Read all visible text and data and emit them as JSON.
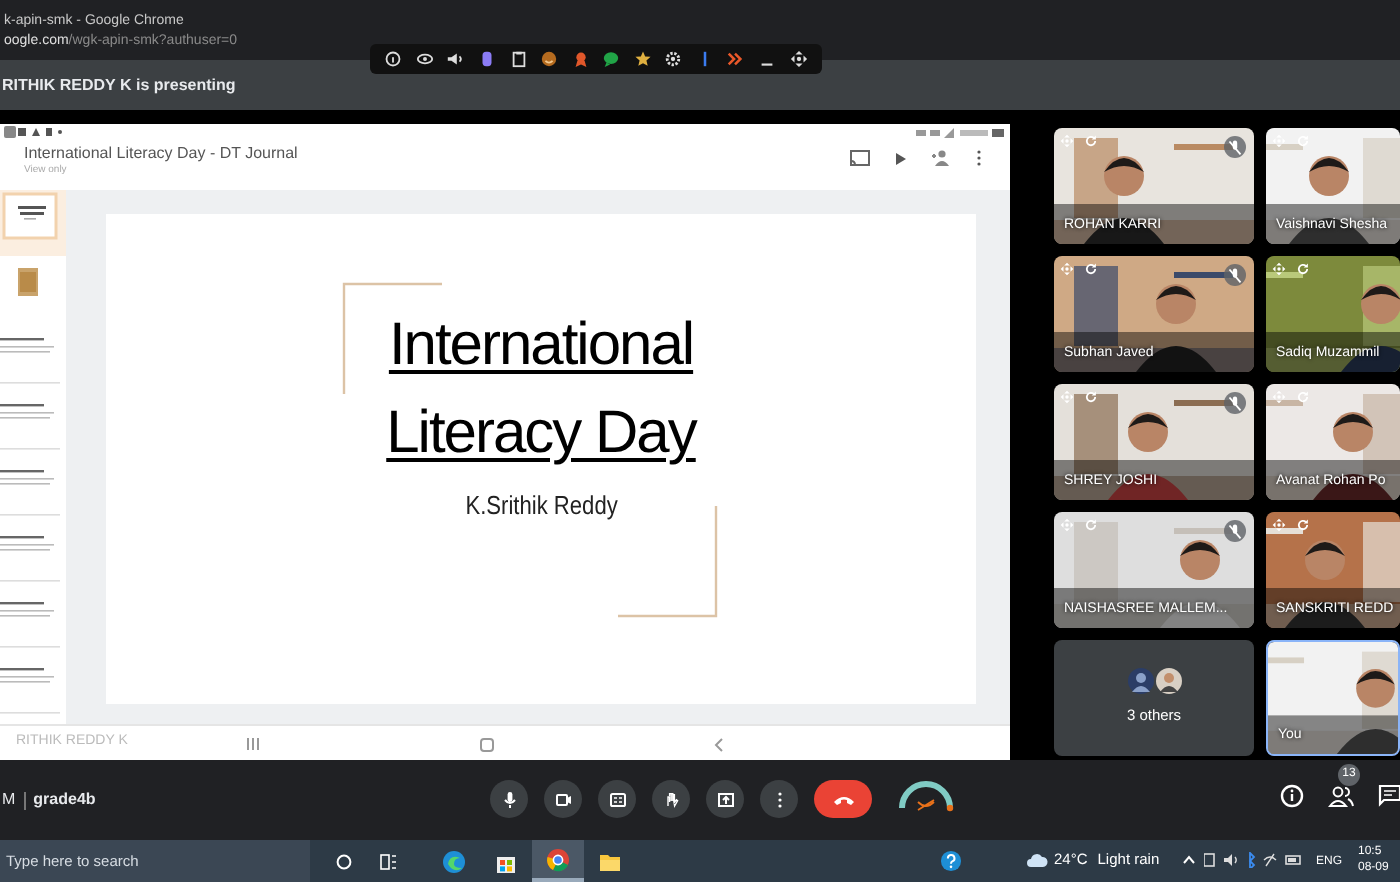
{
  "browser": {
    "title": "k-apin-smk - Google Chrome",
    "url_host": "oogle.com",
    "url_path": "/wgk-apin-smk?authuser=0"
  },
  "presenting_banner": "RITHIK REDDY K is presenting",
  "presentation": {
    "document_title": "International Literacy Day - DT Journal",
    "subtitle": "View only",
    "thumbnails": [
      {
        "selected": true
      },
      {
        "selected": false
      },
      {
        "selected": false
      },
      {
        "selected": false
      },
      {
        "selected": false
      },
      {
        "selected": false
      },
      {
        "selected": false
      },
      {
        "selected": false
      }
    ],
    "slide": {
      "title_lines": [
        "International",
        "Literacy Day"
      ],
      "author": "K.Srithik Reddy"
    },
    "presenter_label": "RITHIK REDDY K"
  },
  "tiles": [
    {
      "kind": "video",
      "name": "ROHAN KARRI",
      "muted": true
    },
    {
      "kind": "video",
      "name": "Vaishnavi Shesha",
      "muted": false
    },
    {
      "kind": "video",
      "name": "Subhan Javed",
      "muted": true
    },
    {
      "kind": "video",
      "name": "Sadiq Muzammil",
      "muted": false
    },
    {
      "kind": "video",
      "name": "SHREY JOSHI",
      "muted": true
    },
    {
      "kind": "video",
      "name": "Avanat Rohan Po",
      "muted": false
    },
    {
      "kind": "video",
      "name": "NAISHASREE MALLEM...",
      "muted": true
    },
    {
      "kind": "video",
      "name": "SANSKRITI REDD",
      "muted": false
    },
    {
      "kind": "others",
      "name": "3 others"
    },
    {
      "kind": "self",
      "name": "You"
    }
  ],
  "meeting": {
    "time_fragment": "M",
    "code": "grade4b",
    "participants_badge": "13"
  },
  "taskbar": {
    "search_placeholder": "Type here to search",
    "temperature": "24°C",
    "weather": "Light rain",
    "language": "ENG",
    "time": "10:5",
    "date": "08-09"
  }
}
